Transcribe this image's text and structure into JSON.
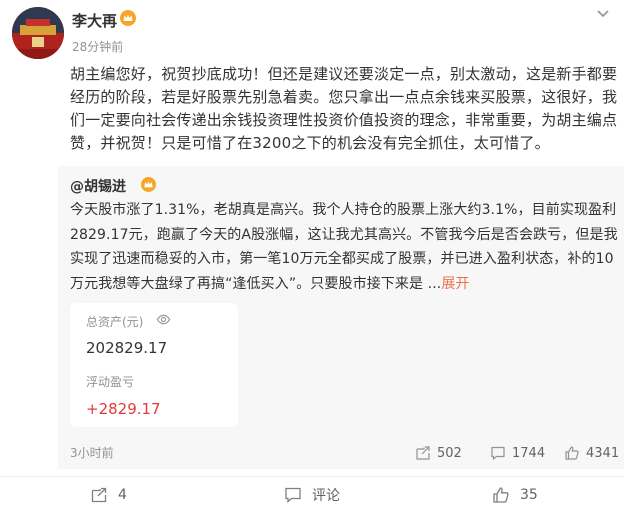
{
  "post": {
    "author": "李大再",
    "time": "28分钟前",
    "text": "胡主编您好，祝贺抄底成功！但还是建议还要淡定一点，别太激动，这是新手都要经历的阶段，若是好股票先别急着卖。您只拿出一点点余钱来买股票，这很好，我们一定要向社会传递出余钱投资理性投资价值投资的理念，非常重要，为胡主编点赞，并祝贺！只是可惜了在3200之下的机会没有完全抓住，太可惜了。"
  },
  "repost": {
    "author": "@胡锡进",
    "text": "今天股市涨了1.31%，老胡真是高兴。我个人持仓的股票上涨大约3.1%，目前实现盈利2829.17元，跑赢了今天的A股涨幅，这让我尤其高兴。不管我今后是否会跌亏，但是我实现了迅速而稳妥的入市，第一笔10万元全都买成了股票，并已进入盈利状态，补的10万元我想等大盘绿了再搞“逢低买入”。只要股市接下来是 ...",
    "expand_label": "展开",
    "card": {
      "asset_label": "总资产(元)",
      "asset_value": "202829.17",
      "pnl_label": "浮动盈亏",
      "pnl_value": "+2829.17"
    },
    "time": "3小时前",
    "reposts": "502",
    "comments": "1744",
    "likes": "4341"
  },
  "actions": {
    "repost_count": "4",
    "comment_label": "评论",
    "like_count": "35"
  },
  "icons": {
    "more": "chevron-down-icon",
    "vip": "vip-crown-icon",
    "eye": "eye-icon",
    "repost": "repost-icon",
    "comment": "comment-icon",
    "like": "thumbs-up-icon"
  },
  "colors": {
    "link": "#eb7350",
    "profit": "#e5383b",
    "vip": "#f7a528",
    "meta": "#939393"
  }
}
